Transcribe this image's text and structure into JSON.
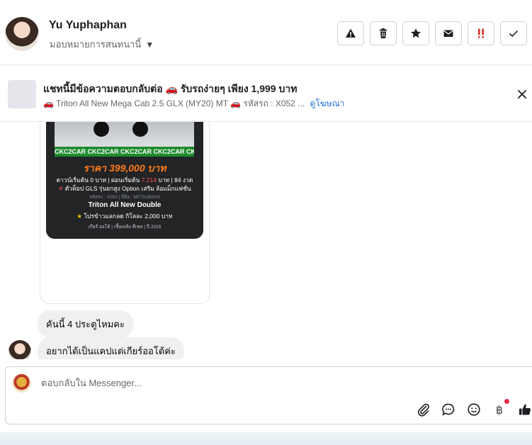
{
  "contact": {
    "name": "Yu Yuphaphan",
    "assign_label": "มอบหมายการสนทนานี้"
  },
  "ad": {
    "title": "แชทนี้มีข้อความตอบกลับต่อ 🚗 รับรถง่ายๆ เพียง 1,999 บาท",
    "subtitle": "🚗 Triton All New Mega Cab 2.5 GLX (MY20) MT 🚗 รหัสรถ : X052 ...",
    "link": "ดูโฆษณา"
  },
  "poster": {
    "strip": "CKC2CAR CKC2CAR CKC2CAR CKC2CAR CKC2CAR",
    "price": "ราคา 399,000 บาท",
    "line1": "ดาวน์เริ่มต้น 0 บาท | ผ่อนเริ่มต้น",
    "line1_red": "7,214",
    "line1_tail": "บาท | 84 งวด",
    "line2_mark": "✳",
    "line2": "ตัวท็อป GLS รุ่นยกสูง Option เสริม ล้อแม็กแฟชั่น",
    "line3": "รหัสรถ : X052 | ยี่ห้อ : MITSUBISHI",
    "line4": "Triton All New Double",
    "line5_mark": "★",
    "line5": "โปรข้าวแลกลด กิโลละ 2,000 บาท",
    "line6": "เกียร์ ออโต้ | เชื้อเพลิง ดีเซล | ปี 2015"
  },
  "messages": [
    {
      "text": "คันนี้ 4 ประตูไหมคะ"
    },
    {
      "text": "อยากได้เป็นแคปแต่เกียร์ออโต้ค่ะ"
    }
  ],
  "composer": {
    "placeholder": "ตอบกลับใน Messenger..."
  },
  "icons": {
    "baht_glyph": "฿"
  }
}
